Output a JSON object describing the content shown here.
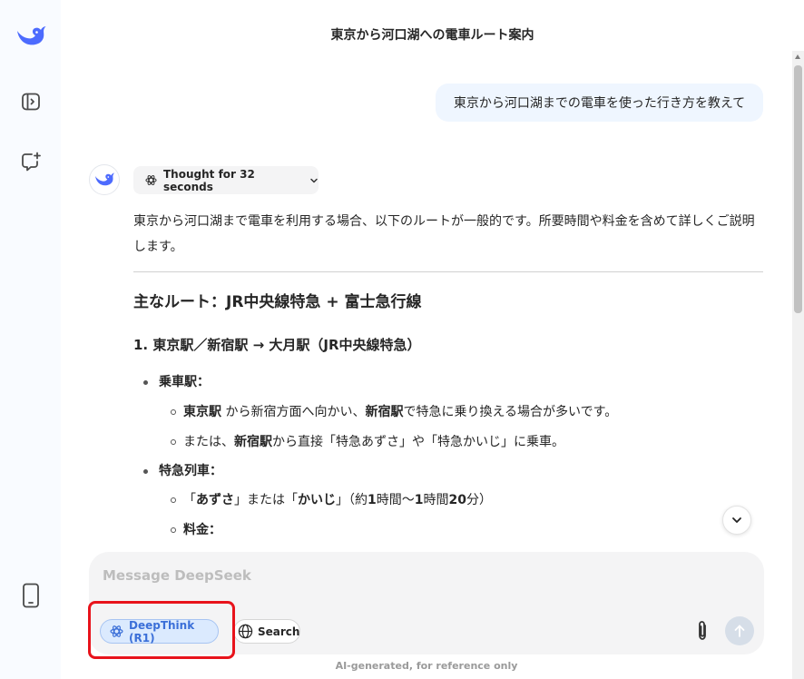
{
  "sidebar": {
    "logo_icon": "deepseek-whale-icon",
    "items": [
      {
        "name": "open-sidebar",
        "icon": "sidebar-toggle-icon"
      },
      {
        "name": "new-chat",
        "icon": "new-chat-icon"
      },
      {
        "name": "get-app",
        "icon": "mobile-phone-icon"
      }
    ]
  },
  "header": {
    "title": "東京から河口湖への電車ルート案内"
  },
  "conversation": {
    "user_message": "東京から河口湖までの電車を使った行き方を教えて",
    "assistant": {
      "thought_label": "Thought for 32 seconds",
      "intro": "東京から河口湖まで電車を利用する場合、以下のルートが一般的です。所要時間や料金を含めて詳しくご説明します。",
      "heading": "主なルート：JR中央線特急 + 富士急行線",
      "step1": {
        "title": "1. 東京駅／新宿駅 → 大月駅（JR中央線特急）",
        "boarding": {
          "label": "乗車駅：",
          "item1_b1": "東京駅",
          "item1_t1": " から新宿方面へ向かい、",
          "item1_b2": "新宿駅",
          "item1_t2": "で特急に乗り換える場合が多いです。",
          "item2_t1": "または、",
          "item2_b1": "新宿駅",
          "item2_t2": "から直接「特急あずさ」や「特急かいじ」に乗車。"
        },
        "express": {
          "label": "特急列車：",
          "item1_t1": "「",
          "item1_b1": "あずさ",
          "item1_t2": "」または「",
          "item1_b2": "かいじ",
          "item1_t3": "」（約",
          "item1_b3": "1",
          "item1_t4": "時間〜",
          "item1_b4": "1",
          "item1_t5": "時間",
          "item1_b5": "20",
          "item1_t6": "分）",
          "item2": "料金："
        }
      }
    }
  },
  "composer": {
    "placeholder": "Message DeepSeek",
    "deepthink_label": "DeepThink (R1)",
    "search_label": "Search",
    "deepthink_active": true
  },
  "footer_note": "AI-generated, for reference only",
  "colors": {
    "accent": "#3b6fd8",
    "brand": "#4d6bfe",
    "highlight": "#e8131b",
    "user_bubble": "#eff6ff"
  }
}
